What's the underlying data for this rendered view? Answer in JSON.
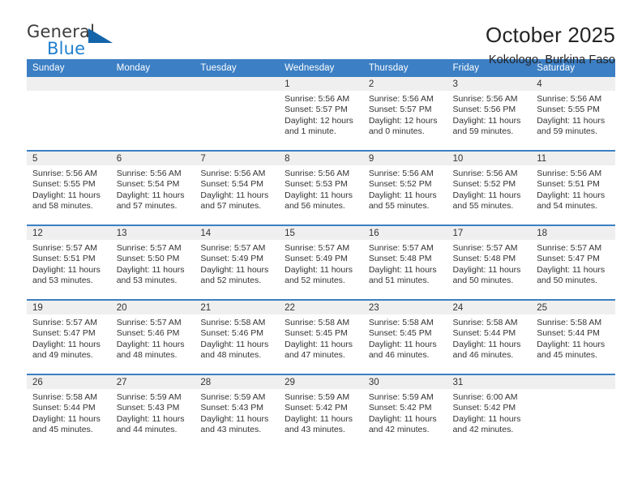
{
  "brand": {
    "name_top": "General",
    "name_bottom": "Blue",
    "triangle_color": "#1464aa",
    "blue_color": "#1f7fd0"
  },
  "header": {
    "title": "October 2025",
    "subtitle": "Kokologo, Burkina Faso"
  },
  "theme": {
    "header_row_bg": "#3c7fc4",
    "daynum_strip_bg": "#efefef",
    "text_color": "#333333"
  },
  "weekdays": [
    "Sunday",
    "Monday",
    "Tuesday",
    "Wednesday",
    "Thursday",
    "Friday",
    "Saturday"
  ],
  "weeks": [
    [
      {
        "day": "",
        "lines": []
      },
      {
        "day": "",
        "lines": []
      },
      {
        "day": "",
        "lines": []
      },
      {
        "day": "1",
        "lines": [
          "Sunrise: 5:56 AM",
          "Sunset: 5:57 PM",
          "Daylight: 12 hours",
          "and 1 minute."
        ]
      },
      {
        "day": "2",
        "lines": [
          "Sunrise: 5:56 AM",
          "Sunset: 5:57 PM",
          "Daylight: 12 hours",
          "and 0 minutes."
        ]
      },
      {
        "day": "3",
        "lines": [
          "Sunrise: 5:56 AM",
          "Sunset: 5:56 PM",
          "Daylight: 11 hours",
          "and 59 minutes."
        ]
      },
      {
        "day": "4",
        "lines": [
          "Sunrise: 5:56 AM",
          "Sunset: 5:55 PM",
          "Daylight: 11 hours",
          "and 59 minutes."
        ]
      }
    ],
    [
      {
        "day": "5",
        "lines": [
          "Sunrise: 5:56 AM",
          "Sunset: 5:55 PM",
          "Daylight: 11 hours",
          "and 58 minutes."
        ]
      },
      {
        "day": "6",
        "lines": [
          "Sunrise: 5:56 AM",
          "Sunset: 5:54 PM",
          "Daylight: 11 hours",
          "and 57 minutes."
        ]
      },
      {
        "day": "7",
        "lines": [
          "Sunrise: 5:56 AM",
          "Sunset: 5:54 PM",
          "Daylight: 11 hours",
          "and 57 minutes."
        ]
      },
      {
        "day": "8",
        "lines": [
          "Sunrise: 5:56 AM",
          "Sunset: 5:53 PM",
          "Daylight: 11 hours",
          "and 56 minutes."
        ]
      },
      {
        "day": "9",
        "lines": [
          "Sunrise: 5:56 AM",
          "Sunset: 5:52 PM",
          "Daylight: 11 hours",
          "and 55 minutes."
        ]
      },
      {
        "day": "10",
        "lines": [
          "Sunrise: 5:56 AM",
          "Sunset: 5:52 PM",
          "Daylight: 11 hours",
          "and 55 minutes."
        ]
      },
      {
        "day": "11",
        "lines": [
          "Sunrise: 5:56 AM",
          "Sunset: 5:51 PM",
          "Daylight: 11 hours",
          "and 54 minutes."
        ]
      }
    ],
    [
      {
        "day": "12",
        "lines": [
          "Sunrise: 5:57 AM",
          "Sunset: 5:51 PM",
          "Daylight: 11 hours",
          "and 53 minutes."
        ]
      },
      {
        "day": "13",
        "lines": [
          "Sunrise: 5:57 AM",
          "Sunset: 5:50 PM",
          "Daylight: 11 hours",
          "and 53 minutes."
        ]
      },
      {
        "day": "14",
        "lines": [
          "Sunrise: 5:57 AM",
          "Sunset: 5:49 PM",
          "Daylight: 11 hours",
          "and 52 minutes."
        ]
      },
      {
        "day": "15",
        "lines": [
          "Sunrise: 5:57 AM",
          "Sunset: 5:49 PM",
          "Daylight: 11 hours",
          "and 52 minutes."
        ]
      },
      {
        "day": "16",
        "lines": [
          "Sunrise: 5:57 AM",
          "Sunset: 5:48 PM",
          "Daylight: 11 hours",
          "and 51 minutes."
        ]
      },
      {
        "day": "17",
        "lines": [
          "Sunrise: 5:57 AM",
          "Sunset: 5:48 PM",
          "Daylight: 11 hours",
          "and 50 minutes."
        ]
      },
      {
        "day": "18",
        "lines": [
          "Sunrise: 5:57 AM",
          "Sunset: 5:47 PM",
          "Daylight: 11 hours",
          "and 50 minutes."
        ]
      }
    ],
    [
      {
        "day": "19",
        "lines": [
          "Sunrise: 5:57 AM",
          "Sunset: 5:47 PM",
          "Daylight: 11 hours",
          "and 49 minutes."
        ]
      },
      {
        "day": "20",
        "lines": [
          "Sunrise: 5:57 AM",
          "Sunset: 5:46 PM",
          "Daylight: 11 hours",
          "and 48 minutes."
        ]
      },
      {
        "day": "21",
        "lines": [
          "Sunrise: 5:58 AM",
          "Sunset: 5:46 PM",
          "Daylight: 11 hours",
          "and 48 minutes."
        ]
      },
      {
        "day": "22",
        "lines": [
          "Sunrise: 5:58 AM",
          "Sunset: 5:45 PM",
          "Daylight: 11 hours",
          "and 47 minutes."
        ]
      },
      {
        "day": "23",
        "lines": [
          "Sunrise: 5:58 AM",
          "Sunset: 5:45 PM",
          "Daylight: 11 hours",
          "and 46 minutes."
        ]
      },
      {
        "day": "24",
        "lines": [
          "Sunrise: 5:58 AM",
          "Sunset: 5:44 PM",
          "Daylight: 11 hours",
          "and 46 minutes."
        ]
      },
      {
        "day": "25",
        "lines": [
          "Sunrise: 5:58 AM",
          "Sunset: 5:44 PM",
          "Daylight: 11 hours",
          "and 45 minutes."
        ]
      }
    ],
    [
      {
        "day": "26",
        "lines": [
          "Sunrise: 5:58 AM",
          "Sunset: 5:44 PM",
          "Daylight: 11 hours",
          "and 45 minutes."
        ]
      },
      {
        "day": "27",
        "lines": [
          "Sunrise: 5:59 AM",
          "Sunset: 5:43 PM",
          "Daylight: 11 hours",
          "and 44 minutes."
        ]
      },
      {
        "day": "28",
        "lines": [
          "Sunrise: 5:59 AM",
          "Sunset: 5:43 PM",
          "Daylight: 11 hours",
          "and 43 minutes."
        ]
      },
      {
        "day": "29",
        "lines": [
          "Sunrise: 5:59 AM",
          "Sunset: 5:42 PM",
          "Daylight: 11 hours",
          "and 43 minutes."
        ]
      },
      {
        "day": "30",
        "lines": [
          "Sunrise: 5:59 AM",
          "Sunset: 5:42 PM",
          "Daylight: 11 hours",
          "and 42 minutes."
        ]
      },
      {
        "day": "31",
        "lines": [
          "Sunrise: 6:00 AM",
          "Sunset: 5:42 PM",
          "Daylight: 11 hours",
          "and 42 minutes."
        ]
      },
      {
        "day": "",
        "lines": []
      }
    ]
  ]
}
